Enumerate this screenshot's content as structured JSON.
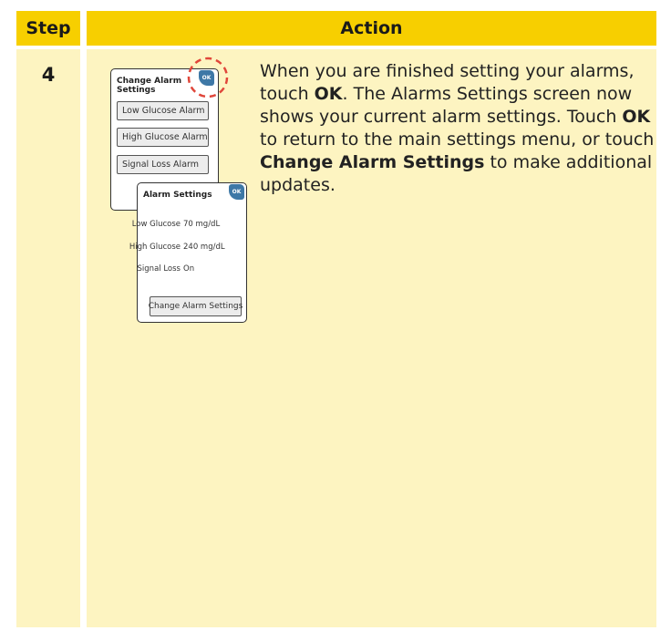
{
  "header": {
    "step": "Step",
    "action": "Action"
  },
  "step_number": "4",
  "screen_change": {
    "title_line1": "Change Alarm",
    "title_line2": "Settings",
    "ok_label": "OK",
    "buttons": [
      "Low Glucose Alarm",
      "High Glucose Alarm",
      "Signal Loss Alarm"
    ]
  },
  "screen_alarm": {
    "title": "Alarm Settings",
    "ok_label": "OK",
    "rows": [
      {
        "label": "Low Glucose",
        "value": "70 mg/dL"
      },
      {
        "label": "High Glucose",
        "value": "240 mg/dL"
      },
      {
        "label": "Signal Loss",
        "value": "On"
      }
    ],
    "change_button": "Change Alarm Settings"
  },
  "colors": {
    "highlight_circle": "#e0463a",
    "ok_button": "#3e78a6",
    "header": "#f7cf00",
    "column": "#fdf4c1"
  },
  "instructions": {
    "t1": "When you are finished setting your alarms, touch ",
    "b1": "OK",
    "t2": ". The Alarms Settings screen now shows your current alarm settings. Touch ",
    "b2": "OK",
    "t3": " to return to the main settings menu, or touch ",
    "b3": "Change Alarm Settings",
    "t4": " to make additional updates."
  }
}
